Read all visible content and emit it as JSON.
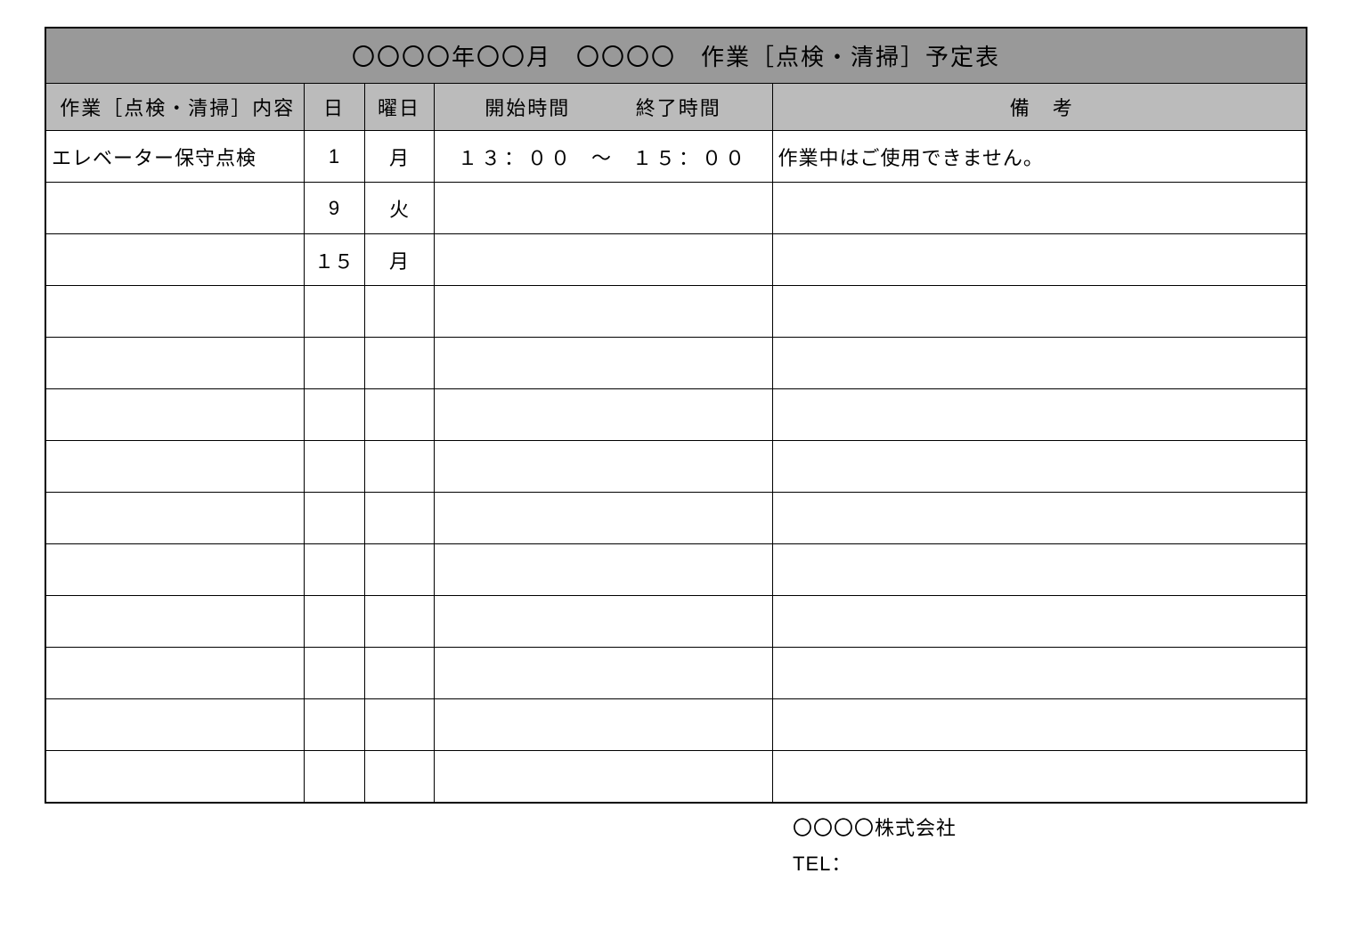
{
  "title": "〇〇〇〇年〇〇月　〇〇〇〇　作業［点検・清掃］予定表",
  "headers": {
    "content": "作業［点検・清掃］内容",
    "day": "日",
    "weekday": "曜日",
    "start_time": "開始時間",
    "end_time": "終了時間",
    "remarks": "備　考"
  },
  "rows": [
    {
      "content": "エレベーター保守点検",
      "day": "1",
      "weekday": "月",
      "start": "１３：００",
      "tilde": "～",
      "end": "１５：００",
      "remarks": "作業中はご使用できません。"
    },
    {
      "content": "",
      "day": "9",
      "weekday": "火",
      "start": "",
      "tilde": "",
      "end": "",
      "remarks": ""
    },
    {
      "content": "",
      "day": "１５",
      "weekday": "月",
      "start": "",
      "tilde": "",
      "end": "",
      "remarks": ""
    },
    {
      "content": "",
      "day": "",
      "weekday": "",
      "start": "",
      "tilde": "",
      "end": "",
      "remarks": ""
    },
    {
      "content": "",
      "day": "",
      "weekday": "",
      "start": "",
      "tilde": "",
      "end": "",
      "remarks": ""
    },
    {
      "content": "",
      "day": "",
      "weekday": "",
      "start": "",
      "tilde": "",
      "end": "",
      "remarks": ""
    },
    {
      "content": "",
      "day": "",
      "weekday": "",
      "start": "",
      "tilde": "",
      "end": "",
      "remarks": ""
    },
    {
      "content": "",
      "day": "",
      "weekday": "",
      "start": "",
      "tilde": "",
      "end": "",
      "remarks": ""
    },
    {
      "content": "",
      "day": "",
      "weekday": "",
      "start": "",
      "tilde": "",
      "end": "",
      "remarks": ""
    },
    {
      "content": "",
      "day": "",
      "weekday": "",
      "start": "",
      "tilde": "",
      "end": "",
      "remarks": ""
    },
    {
      "content": "",
      "day": "",
      "weekday": "",
      "start": "",
      "tilde": "",
      "end": "",
      "remarks": ""
    },
    {
      "content": "",
      "day": "",
      "weekday": "",
      "start": "",
      "tilde": "",
      "end": "",
      "remarks": ""
    },
    {
      "content": "",
      "day": "",
      "weekday": "",
      "start": "",
      "tilde": "",
      "end": "",
      "remarks": ""
    }
  ],
  "footer": {
    "company": "〇〇〇〇株式会社",
    "tel_label": "TEL："
  }
}
